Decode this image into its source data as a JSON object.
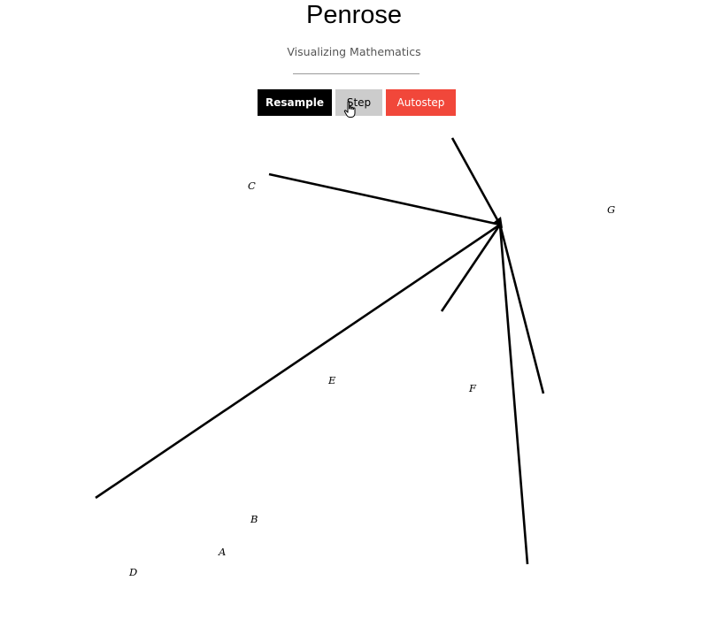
{
  "header": {
    "title": "Penrose",
    "subtitle": "Visualizing Mathematics"
  },
  "toolbar": {
    "resample_label": "Resample",
    "step_label": "Step",
    "autostep_label": "Autostep",
    "colors": {
      "resample": "#000000",
      "step": "#cccccc",
      "autostep": "#f1473a"
    }
  },
  "diagram": {
    "labels": [
      "A",
      "B",
      "C",
      "D",
      "E",
      "F",
      "G"
    ]
  }
}
